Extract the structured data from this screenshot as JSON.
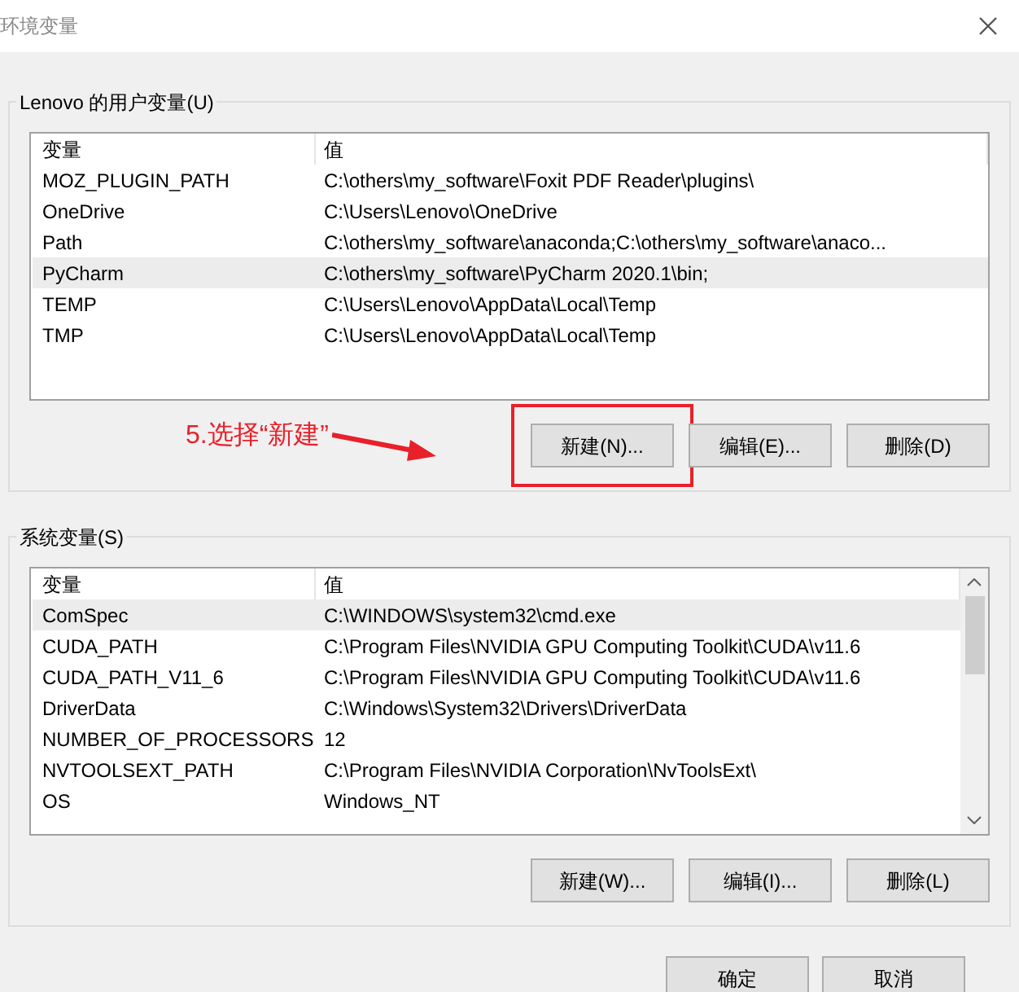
{
  "window": {
    "title": "环境变量"
  },
  "user_variables": {
    "title": "Lenovo 的用户变量(U)",
    "columns": [
      "变量",
      "值"
    ],
    "rows": [
      {
        "name": "MOZ_PLUGIN_PATH",
        "value": "C:\\others\\my_software\\Foxit PDF Reader\\plugins\\",
        "selected": false
      },
      {
        "name": "OneDrive",
        "value": "C:\\Users\\Lenovo\\OneDrive",
        "selected": false
      },
      {
        "name": "Path",
        "value": "C:\\others\\my_software\\anaconda;C:\\others\\my_software\\anaco...",
        "selected": false
      },
      {
        "name": "PyCharm",
        "value": "C:\\others\\my_software\\PyCharm 2020.1\\bin;",
        "selected": true
      },
      {
        "name": "TEMP",
        "value": "C:\\Users\\Lenovo\\AppData\\Local\\Temp",
        "selected": false
      },
      {
        "name": "TMP",
        "value": "C:\\Users\\Lenovo\\AppData\\Local\\Temp",
        "selected": false
      }
    ],
    "buttons": [
      {
        "label": "新建(N)...",
        "highlighted": true
      },
      {
        "label": "编辑(E)...",
        "highlighted": false
      },
      {
        "label": "删除(D)",
        "highlighted": false
      }
    ],
    "annotation": "5.选择“新建”"
  },
  "system_variables": {
    "title": "系统变量(S)",
    "columns": [
      "变量",
      "值"
    ],
    "rows": [
      {
        "name": "ComSpec",
        "value": "C:\\WINDOWS\\system32\\cmd.exe",
        "selected": true
      },
      {
        "name": "CUDA_PATH",
        "value": "C:\\Program Files\\NVIDIA GPU Computing Toolkit\\CUDA\\v11.6",
        "selected": false
      },
      {
        "name": "CUDA_PATH_V11_6",
        "value": "C:\\Program Files\\NVIDIA GPU Computing Toolkit\\CUDA\\v11.6",
        "selected": false
      },
      {
        "name": "DriverData",
        "value": "C:\\Windows\\System32\\Drivers\\DriverData",
        "selected": false
      },
      {
        "name": "NUMBER_OF_PROCESSORS",
        "value": "12",
        "selected": false
      },
      {
        "name": "NVTOOLSEXT_PATH",
        "value": "C:\\Program Files\\NVIDIA Corporation\\NvToolsExt\\",
        "selected": false
      },
      {
        "name": "OS",
        "value": "Windows_NT",
        "selected": false
      }
    ],
    "buttons": [
      {
        "label": "新建(W)...",
        "highlighted": false
      },
      {
        "label": "编辑(I)...",
        "highlighted": false
      },
      {
        "label": "删除(L)",
        "highlighted": false
      }
    ]
  },
  "footer_buttons": [
    "确定",
    "取消"
  ]
}
